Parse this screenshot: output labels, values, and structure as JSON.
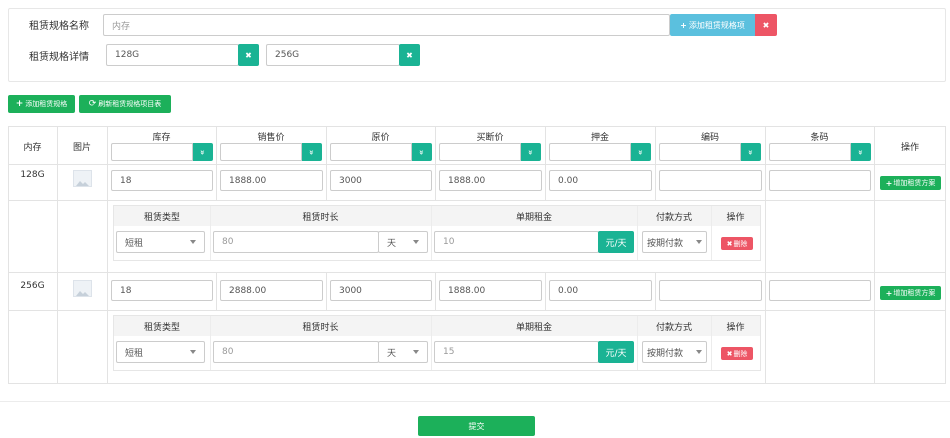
{
  "spec": {
    "name_label": "租赁规格名称",
    "name_value": "内存",
    "add_spec_button": "添加租赁规格项",
    "detail_label": "租赁规格详情",
    "details": [
      "128G",
      "256G"
    ]
  },
  "toolbar": {
    "add_button": "添加租赁规格",
    "refresh_button": "刷新租赁规格项目表"
  },
  "table": {
    "headers": {
      "memory": "内存",
      "image": "图片",
      "stock": "库存",
      "price": "销售价",
      "original": "原价",
      "buyout": "买断价",
      "deposit": "押金",
      "code": "编码",
      "barcode": "条码",
      "action": "操作"
    },
    "add_plan_button": "增加租赁方案",
    "rows": [
      {
        "memory": "128G",
        "stock": "18",
        "price": "1888.00",
        "original": "3000",
        "buyout": "1888.00",
        "deposit": "0.00",
        "code": "",
        "barcode": "",
        "plan": {
          "type": "短租",
          "duration": "80",
          "unit": "天",
          "rent": "10",
          "rent_unit": "元/天",
          "payment": "按期付款"
        }
      },
      {
        "memory": "256G",
        "stock": "18",
        "price": "2888.00",
        "original": "3000",
        "buyout": "1888.00",
        "deposit": "0.00",
        "code": "",
        "barcode": "",
        "plan": {
          "type": "短租",
          "duration": "80",
          "unit": "天",
          "rent": "15",
          "rent_unit": "元/天",
          "payment": "按期付款"
        }
      }
    ],
    "plan_headers": {
      "type": "租赁类型",
      "duration": "租赁时长",
      "rent": "单期租金",
      "payment": "付款方式",
      "action": "操作"
    },
    "delete_button": "删除"
  },
  "submit_button": "提交",
  "colors": {
    "teal": "#1ab394",
    "green": "#1cb05a",
    "red": "#ed5565",
    "light_blue": "#5bc0de"
  }
}
